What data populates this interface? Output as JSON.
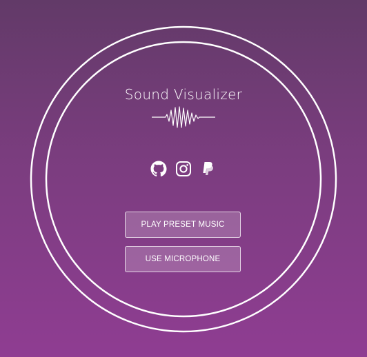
{
  "app": {
    "title": "Sound Visualizer"
  },
  "icons": {
    "wave": "sound-wave-icon",
    "social": [
      "github-icon",
      "instagram-icon",
      "paypal-icon"
    ]
  },
  "buttons": {
    "play_preset": "PLAY PRESET MUSIC",
    "use_microphone": "USE MICROPHONE"
  },
  "colors": {
    "background_top": "#623a68",
    "background_bottom": "#8f3d92",
    "foreground": "#ffffff"
  }
}
